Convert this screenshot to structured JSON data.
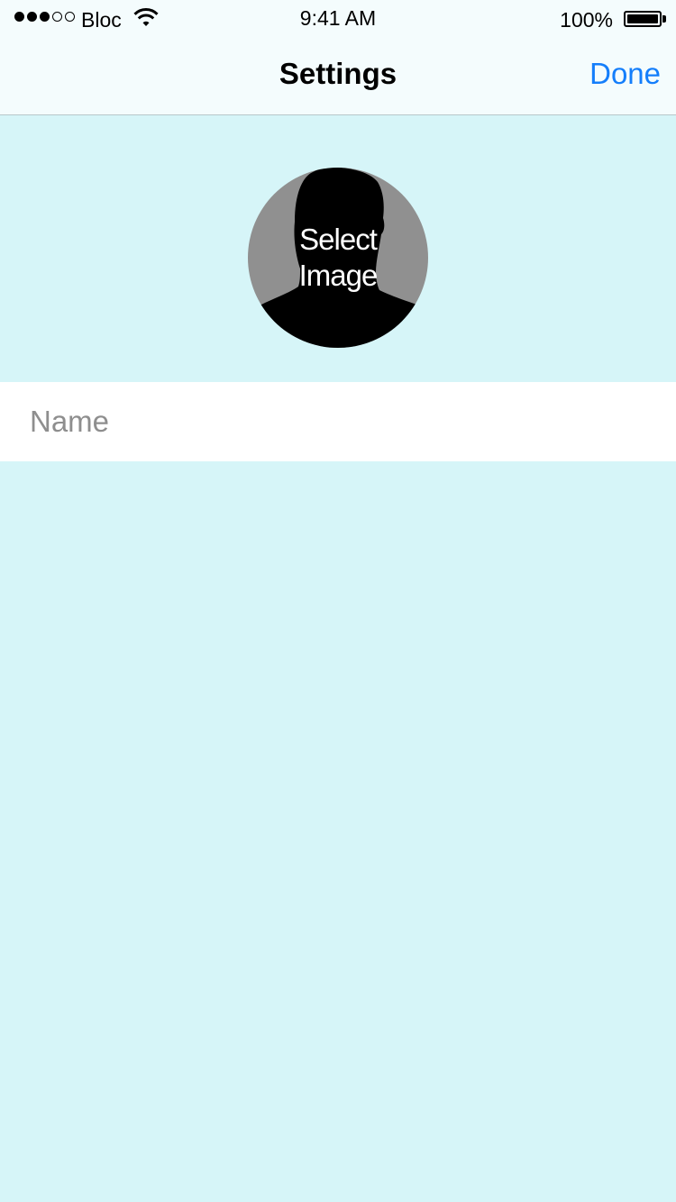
{
  "status_bar": {
    "carrier": "Bloc",
    "time": "9:41 AM",
    "battery_percent": "100%",
    "signal_bars_filled": 3,
    "signal_bars_total": 5,
    "battery_level": 1.0
  },
  "nav": {
    "title": "Settings",
    "done_label": "Done"
  },
  "profile": {
    "select_image_label": "Select\nImage"
  },
  "name_field": {
    "placeholder": "Name",
    "value": ""
  },
  "colors": {
    "background": "#d6f5f8",
    "nav_background": "#f4fcfd",
    "accent": "#147efb",
    "avatar_gray": "#909090",
    "placeholder": "#8e8e8e"
  },
  "icons": {
    "wifi": "wifi-icon",
    "battery": "battery-icon",
    "avatar": "person-silhouette-icon"
  }
}
